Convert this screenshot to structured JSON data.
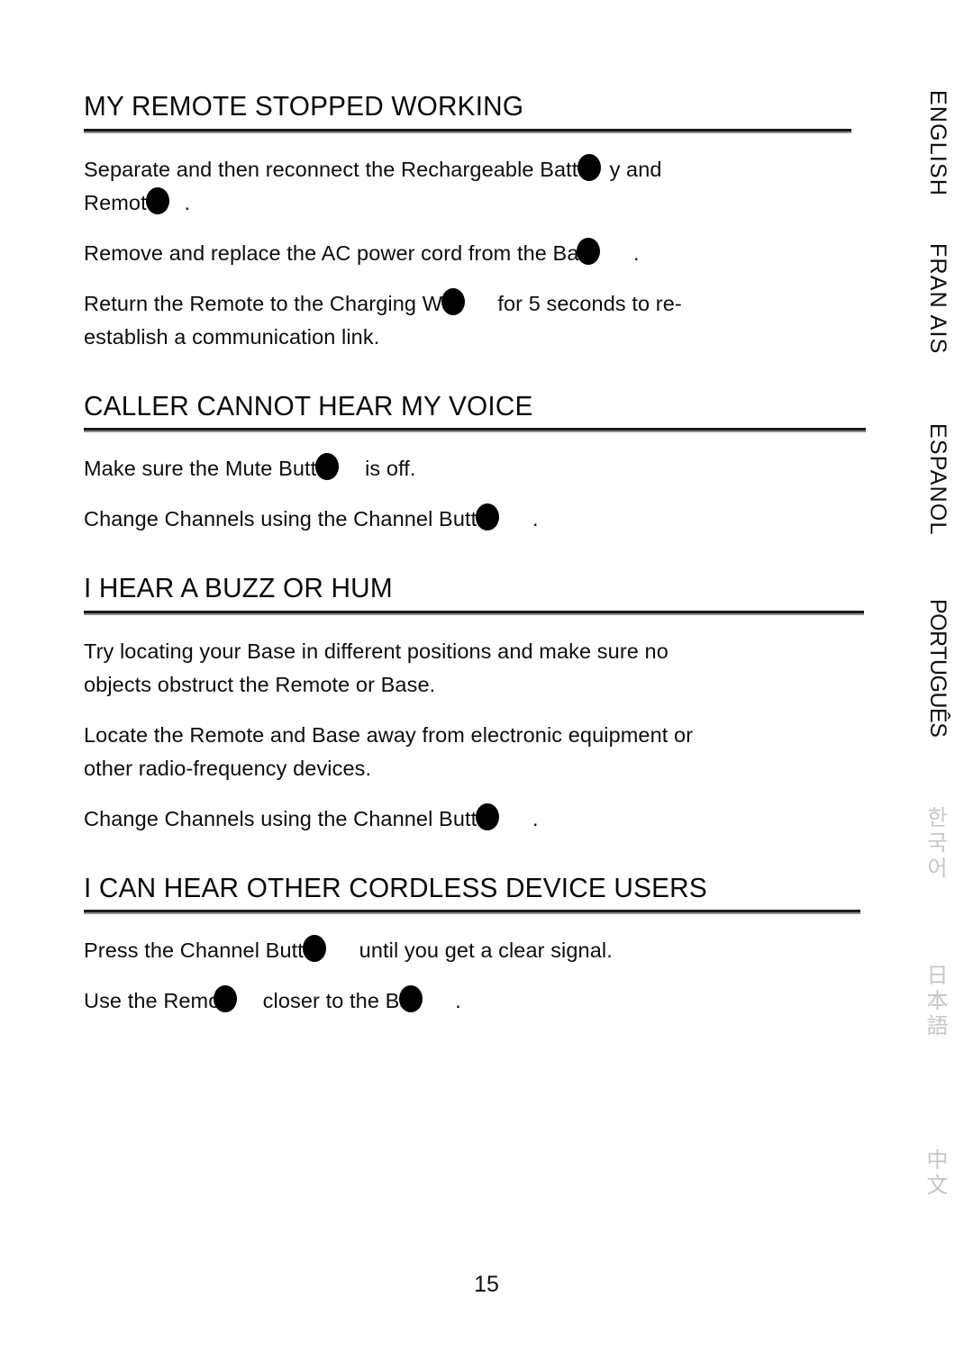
{
  "document": {
    "page_number": "15"
  },
  "sections": [
    {
      "heading": "MY REMOTE STOPPED WORKING",
      "paragraphs": [
        {
          "parts": [
            "Separate and then reconnect the Rechargeable Batte",
            "y         and",
            "Remote",
            " ."
          ]
        },
        {
          "parts": [
            "Remove and replace the AC power cord from the Bas",
            " ."
          ]
        },
        {
          "parts": [
            "Return the Remote to the Charging We",
            " for 5 seconds to re-",
            "establish a communication link."
          ]
        }
      ]
    },
    {
      "heading": "CALLER CANNOT HEAR MY VOICE",
      "paragraphs": [
        {
          "parts": [
            "Make sure the Mute Butto",
            " is off."
          ]
        },
        {
          "parts": [
            "Change Channels using the Channel Butto",
            " ."
          ]
        }
      ]
    },
    {
      "heading": "I HEAR A BUZZ OR HUM",
      "paragraphs": [
        {
          "parts": [
            "Try locating your Base in different positions and make sure no",
            "objects obstruct the Remote or Base."
          ]
        },
        {
          "parts": [
            "Locate the Remote and Base away from electronic equipment or",
            "other radio-frequency devices."
          ]
        },
        {
          "parts": [
            "Change Channels using the Channel Butto",
            " ."
          ]
        }
      ]
    },
    {
      "heading": "I CAN HEAR OTHER CORDLESS DEVICE USERS",
      "paragraphs": [
        {
          "parts": [
            "Press the Channel Butto",
            " until you get a clear signal."
          ]
        },
        {
          "parts": [
            "Use the Remot",
            " closer to the Ba",
            " ."
          ]
        }
      ]
    }
  ],
  "language_tabs": [
    {
      "label": "ENGLISH",
      "style": "latin"
    },
    {
      "label": "FRAN AIS",
      "style": "latin"
    },
    {
      "label": "ESPANOL",
      "style": "latin"
    },
    {
      "label": "PORTUGUÊS",
      "style": "latin"
    },
    {
      "label": "한국어",
      "style": "cjk"
    },
    {
      "label": "日本語",
      "style": "cjk"
    },
    {
      "label": "中文",
      "style": "cjk"
    }
  ],
  "colors": {
    "text": "#0d0d0d",
    "rule_dark": "#1a1a1a",
    "rule_light": "#8e8e8e",
    "inactive_tab": "#c6c6c6",
    "background": "#ffffff"
  }
}
